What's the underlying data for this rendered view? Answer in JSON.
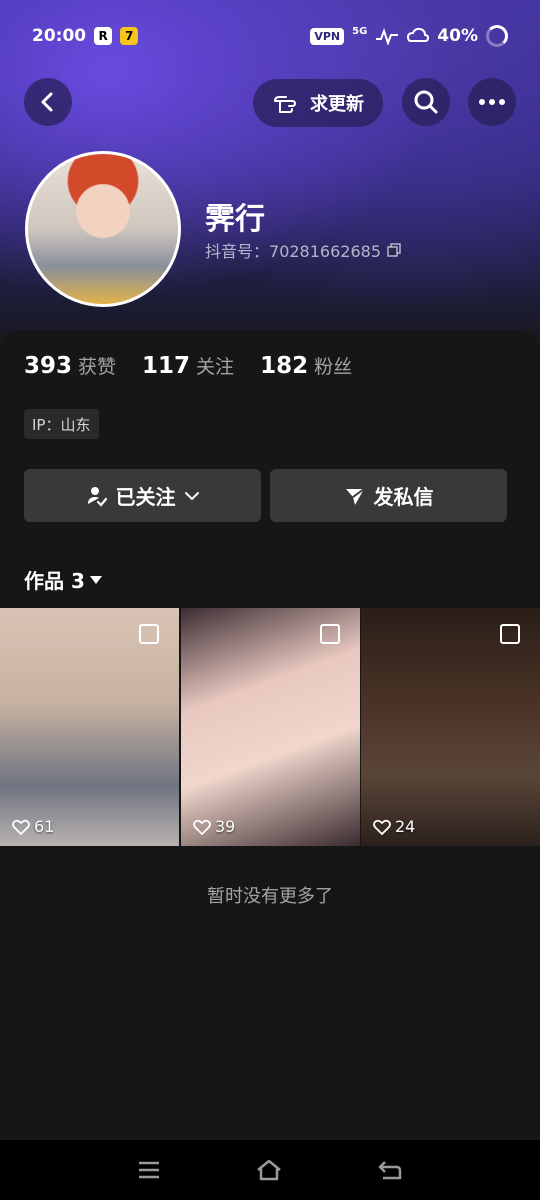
{
  "status_bar": {
    "time": "20:00",
    "app_badges": [
      "R",
      "7"
    ],
    "vpn_label": "VPN",
    "network": "5G",
    "battery": "40%"
  },
  "header": {
    "request_update_label": "求更新",
    "icons": [
      "back-icon",
      "hand-pointer-icon",
      "search-icon",
      "more-icon"
    ]
  },
  "profile": {
    "name": "霁行",
    "douyin_id_label": "抖音号：",
    "douyin_id": "70281662685"
  },
  "stats": [
    {
      "value": "393",
      "label": "获赞"
    },
    {
      "value": "117",
      "label": "关注"
    },
    {
      "value": "182",
      "label": "粉丝"
    }
  ],
  "ip": {
    "label": "IP：",
    "value": "山东"
  },
  "actions": {
    "following_label": "已关注",
    "message_label": "发私信"
  },
  "works": {
    "title": "作品",
    "count": "3"
  },
  "thumbnails": [
    {
      "likes": "61",
      "colors": [
        "#d9c3b4",
        "#6f7380"
      ]
    },
    {
      "likes": "39",
      "colors": [
        "#e8c8c0",
        "#3a2a2e"
      ]
    },
    {
      "likes": "24",
      "colors": [
        "#2a1e18",
        "#5a4638"
      ]
    }
  ],
  "end_note": "暂时没有更多了",
  "colors": {
    "background": "#161616",
    "button": "#393939",
    "accent_header": "#3a2f9a"
  }
}
